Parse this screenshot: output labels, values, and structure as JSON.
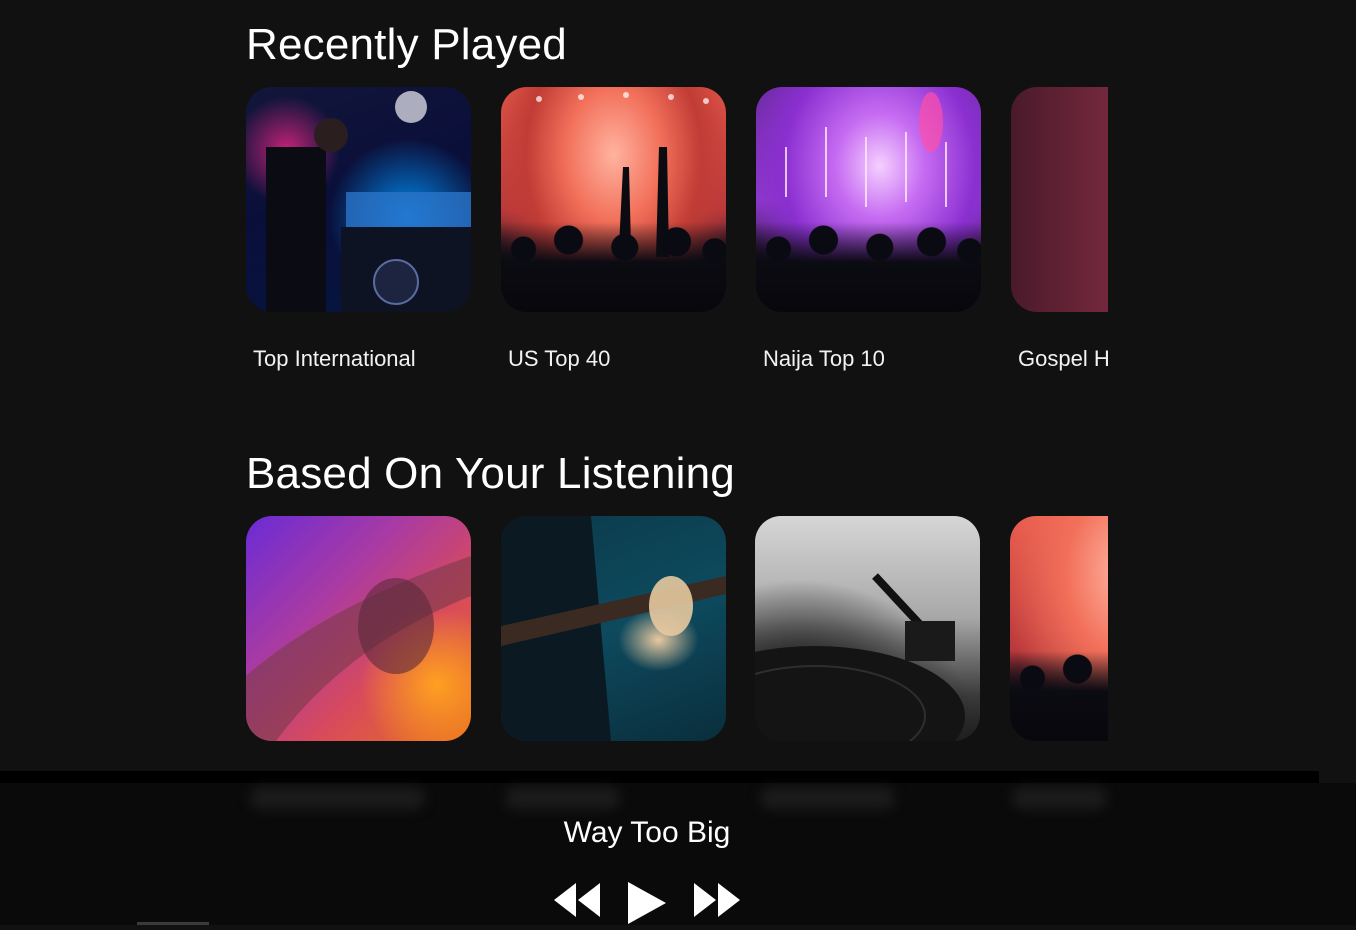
{
  "sections": {
    "recently_played": {
      "title": "Recently Played",
      "items": [
        {
          "label": "Top International",
          "image": "dj-mixing-artwork"
        },
        {
          "label": "US Top 40",
          "image": "concert-crowd-artwork"
        },
        {
          "label": "Naija Top 10",
          "image": "fireworks-concert-artwork"
        },
        {
          "label": "Gospel H",
          "image": "microphone-artwork"
        }
      ]
    },
    "based_on_listening": {
      "title": "Based On Your Listening",
      "items": [
        {
          "image": "electric-guitar-artwork"
        },
        {
          "image": "acoustic-guitar-artwork"
        },
        {
          "image": "vinyl-turntable-artwork"
        },
        {
          "image": "concert-crowd-artwork"
        }
      ]
    }
  },
  "player": {
    "track_title": "Way Too Big",
    "controls": [
      "rewind-icon",
      "play-icon",
      "fast-forward-icon"
    ]
  }
}
